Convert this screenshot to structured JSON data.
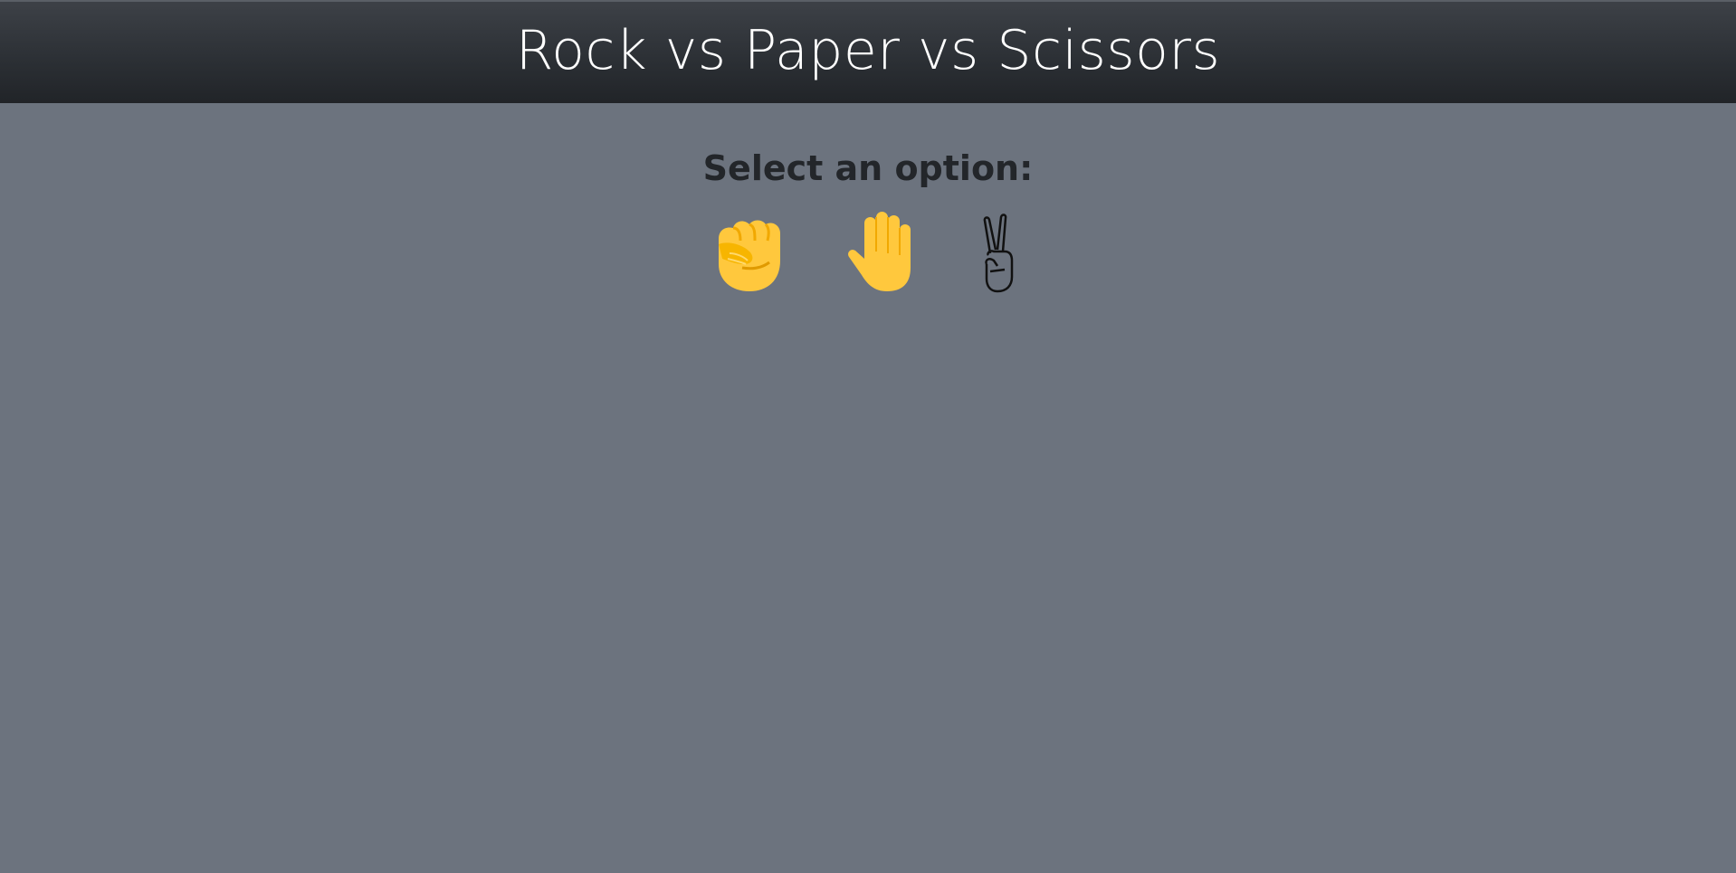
{
  "header": {
    "title": "Rock vs Paper vs Scissors"
  },
  "main": {
    "prompt": "Select an option:",
    "options": [
      {
        "id": "rock",
        "icon": "raised-fist-icon",
        "glyph": "✊"
      },
      {
        "id": "paper",
        "icon": "raised-hand-icon",
        "glyph": "✋"
      },
      {
        "id": "scissors",
        "icon": "victory-hand-icon",
        "glyph": "✌"
      }
    ]
  },
  "colors": {
    "background": "#6c737e",
    "header": "#2b2f34",
    "title_text": "#ffffff",
    "prompt_text": "#23262a",
    "emoji_yellow": "#ffc83d"
  }
}
